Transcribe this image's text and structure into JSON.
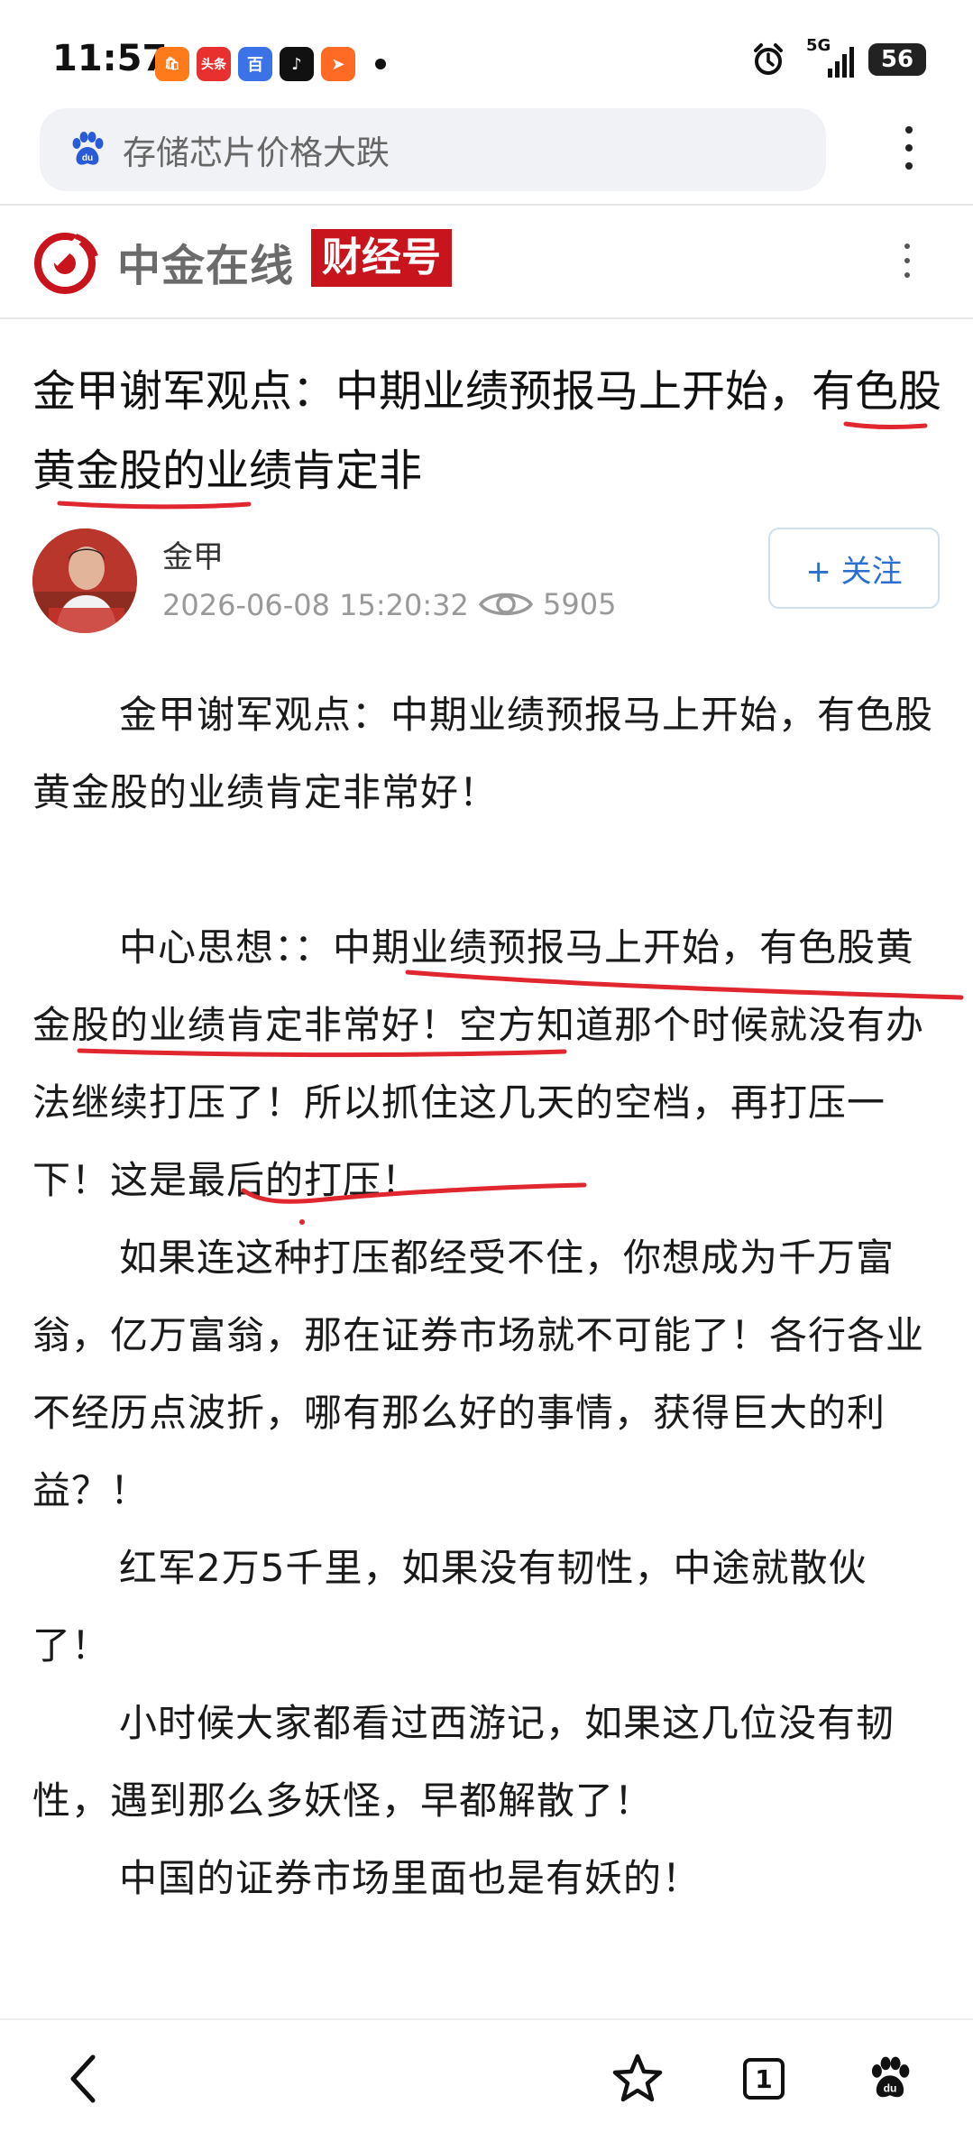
{
  "status_bar": {
    "time": "11:57",
    "app_icons": [
      {
        "name": "app-shop-icon",
        "label": "🛍",
        "color": "#ff7a1a"
      },
      {
        "name": "app-toutiao-icon",
        "label": "头条",
        "color": "#e8302f"
      },
      {
        "name": "app-baidu-icon",
        "label": "百",
        "color": "#3b72e8"
      },
      {
        "name": "app-douyin-icon",
        "label": "♪",
        "color": "#111111"
      },
      {
        "name": "app-messenger-icon",
        "label": "➤",
        "color": "#ff6a25"
      }
    ],
    "network": "5G",
    "battery": "56"
  },
  "browser": {
    "search_query": "存储芯片价格大跌"
  },
  "source": {
    "name": "中金在线",
    "tag": "财经号",
    "brand_color": "#c8151d"
  },
  "article": {
    "title": "金甲谢军观点：中期业绩预报马上开始，有色股黄金股的业绩肯定非",
    "author": "金甲",
    "date": "2026-06-08 15:20:32",
    "views": "5905",
    "follow_label": "+ 关注",
    "paragraphs": [
      "金甲谢军观点：中期业绩预报马上开始，有色股黄金股的业绩肯定非常好！",
      "",
      "中心思想：：中期业绩预报马上开始，有色股黄金股的业绩肯定非常好！空方知道那个时候就没有办法继续打压了！所以抓住这几天的空档，再打压一下！这是最后的打压！",
      "如果连这种打压都经受不住，你想成为千万富翁，亿万富翁，那在证券市场就不可能了！各行各业不经历点波折，哪有那么好的事情，获得巨大的利益？！",
      "红军2万5千里，如果没有韧性，中途就散伙了！",
      "小时候大家都看过西游记，如果这几位没有韧性，遇到那么多妖怪，早都解散了！",
      "中国的证券市场里面也是有妖的！"
    ]
  },
  "bottom_nav": {
    "tab_count": "1"
  },
  "colors": {
    "annotation_red": "#e0262e",
    "link_blue": "#2a6fd1"
  }
}
